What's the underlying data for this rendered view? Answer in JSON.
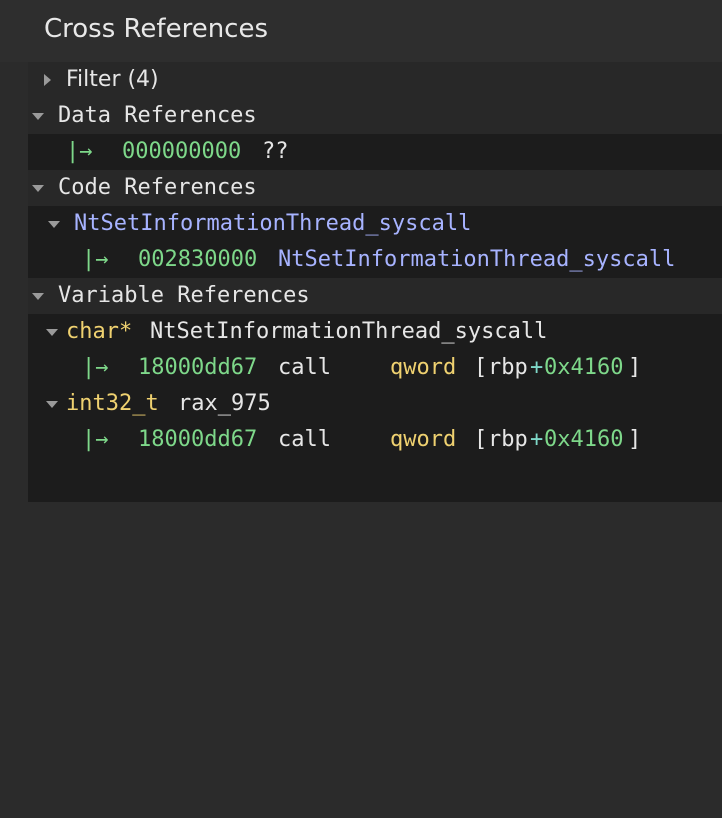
{
  "panel": {
    "title": "Cross References"
  },
  "filter": {
    "label": "Filter (4)"
  },
  "sections": {
    "data": {
      "label": "Data References"
    },
    "code": {
      "label": "Code References"
    },
    "variable": {
      "label": "Variable References"
    }
  },
  "data_refs": [
    {
      "arrow": "|→",
      "address": "000000000",
      "text": "??"
    }
  ],
  "code_refs": {
    "function": "NtSetInformationThread_syscall",
    "items": [
      {
        "arrow": "|→",
        "address": "002830000",
        "text": "NtSetInformationThread_syscall"
      }
    ]
  },
  "variable_refs": [
    {
      "type": "char*",
      "name": "NtSetInformationThread_syscall",
      "items": [
        {
          "arrow": "|→",
          "address": "18000dd67",
          "mnemonic": "call",
          "size": "qword",
          "open": "[",
          "reg": "rbp",
          "plus": "+",
          "offset": "0x4160",
          "close": "]"
        }
      ]
    },
    {
      "type": "int32_t",
      "name": "rax_975",
      "items": [
        {
          "arrow": "|→",
          "address": "18000dd67",
          "mnemonic": "call",
          "size": "qword",
          "open": "[",
          "reg": "rbp",
          "plus": "+",
          "offset": "0x4160",
          "close": "]"
        }
      ]
    }
  ],
  "colors": {
    "address": "#7ed88a",
    "symbol": "#a7b3ff",
    "type": "#efd170",
    "background": "#1c1c1c"
  }
}
